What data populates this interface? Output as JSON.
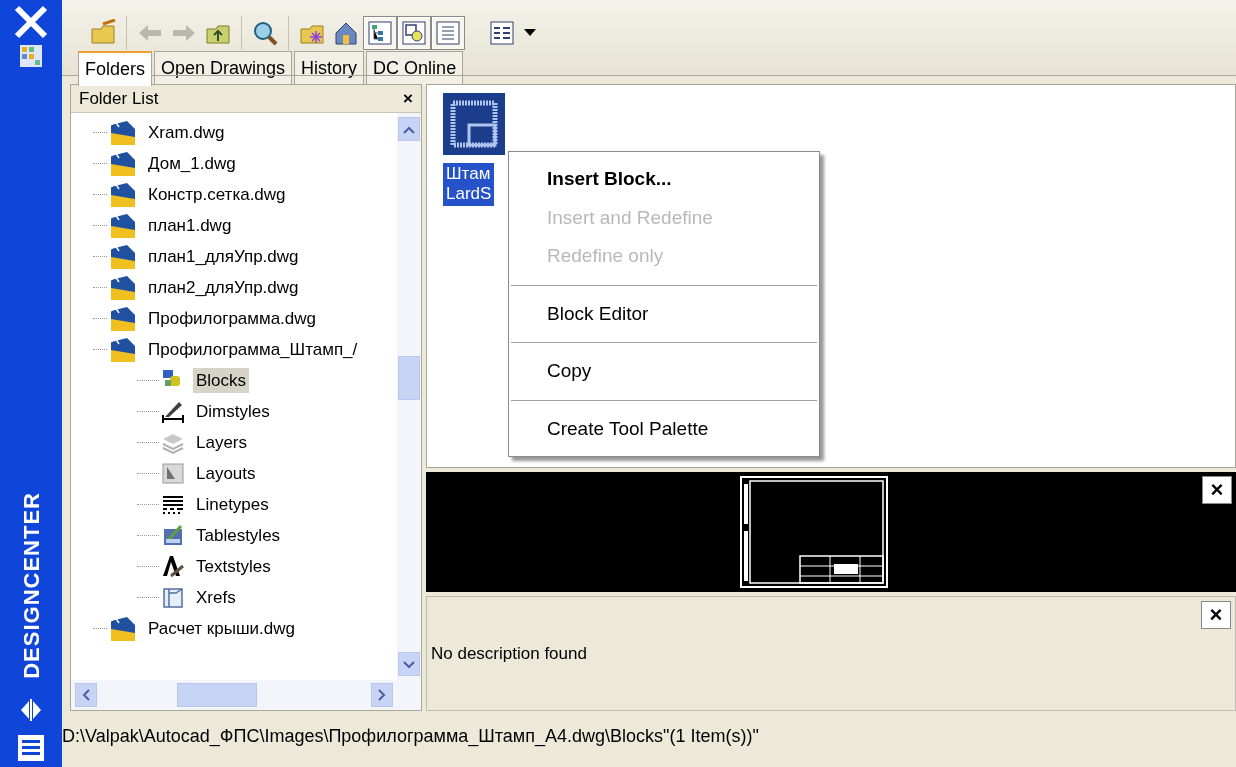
{
  "sidebar": {
    "title": "DESIGNCENTER"
  },
  "toolbar": {
    "toggles": [
      {
        "on": true
      },
      {
        "on": true
      },
      {
        "on": true
      }
    ]
  },
  "tabs": [
    {
      "label": "Folders",
      "selected": true
    },
    {
      "label": "Open Drawings",
      "selected": false
    },
    {
      "label": "History",
      "selected": false
    },
    {
      "label": "DC Online",
      "selected": false
    }
  ],
  "folder_list": {
    "title": "Folder List",
    "close": "×",
    "items": [
      {
        "label": "Xram.dwg",
        "selected": false
      },
      {
        "label": "Дом_1.dwg",
        "selected": false
      },
      {
        "label": "Констр.сетка.dwg",
        "selected": false
      },
      {
        "label": "план1.dwg",
        "selected": false
      },
      {
        "label": "план1_дляУпр.dwg",
        "selected": false
      },
      {
        "label": "план2_дляУпр.dwg",
        "selected": false
      },
      {
        "label": "Профилограмма.dwg",
        "selected": false
      },
      {
        "label": "Профилограмма_Штамп_/",
        "selected": false,
        "children": [
          {
            "label": "Blocks",
            "selected": true
          },
          {
            "label": "Dimstyles",
            "selected": false
          },
          {
            "label": "Layers",
            "selected": false
          },
          {
            "label": "Layouts",
            "selected": false
          },
          {
            "label": "Linetypes",
            "selected": false
          },
          {
            "label": "Tablestyles",
            "selected": false
          },
          {
            "label": "Textstyles",
            "selected": false
          },
          {
            "label": "Xrefs",
            "selected": false
          }
        ]
      },
      {
        "label": "Расчет крыши.dwg",
        "selected": false
      }
    ]
  },
  "content": {
    "items": [
      {
        "lines": [
          "Штам",
          "LardS"
        ],
        "selected": true
      }
    ]
  },
  "context_menu": [
    {
      "kind": "item",
      "label": "Insert Block...",
      "default": true,
      "disabled": false
    },
    {
      "kind": "item",
      "label": "Insert and Redefine",
      "default": false,
      "disabled": true
    },
    {
      "kind": "item",
      "label": "Redefine only",
      "default": false,
      "disabled": true
    },
    {
      "kind": "separator"
    },
    {
      "kind": "item",
      "label": "Block Editor",
      "default": false,
      "disabled": false
    },
    {
      "kind": "separator"
    },
    {
      "kind": "item",
      "label": "Copy",
      "default": false,
      "disabled": false
    },
    {
      "kind": "separator"
    },
    {
      "kind": "item",
      "label": "Create Tool Palette",
      "default": false,
      "disabled": false
    }
  ],
  "preview": {
    "close": "×"
  },
  "description": {
    "text": "No description found",
    "close": "×"
  },
  "status_bar": {
    "text": "D:\\Valpak\\Autocad_ФПС\\Images\\Профилограмма_Штамп_А4.dwg\\Blocks\"(1 Item(s))\""
  }
}
